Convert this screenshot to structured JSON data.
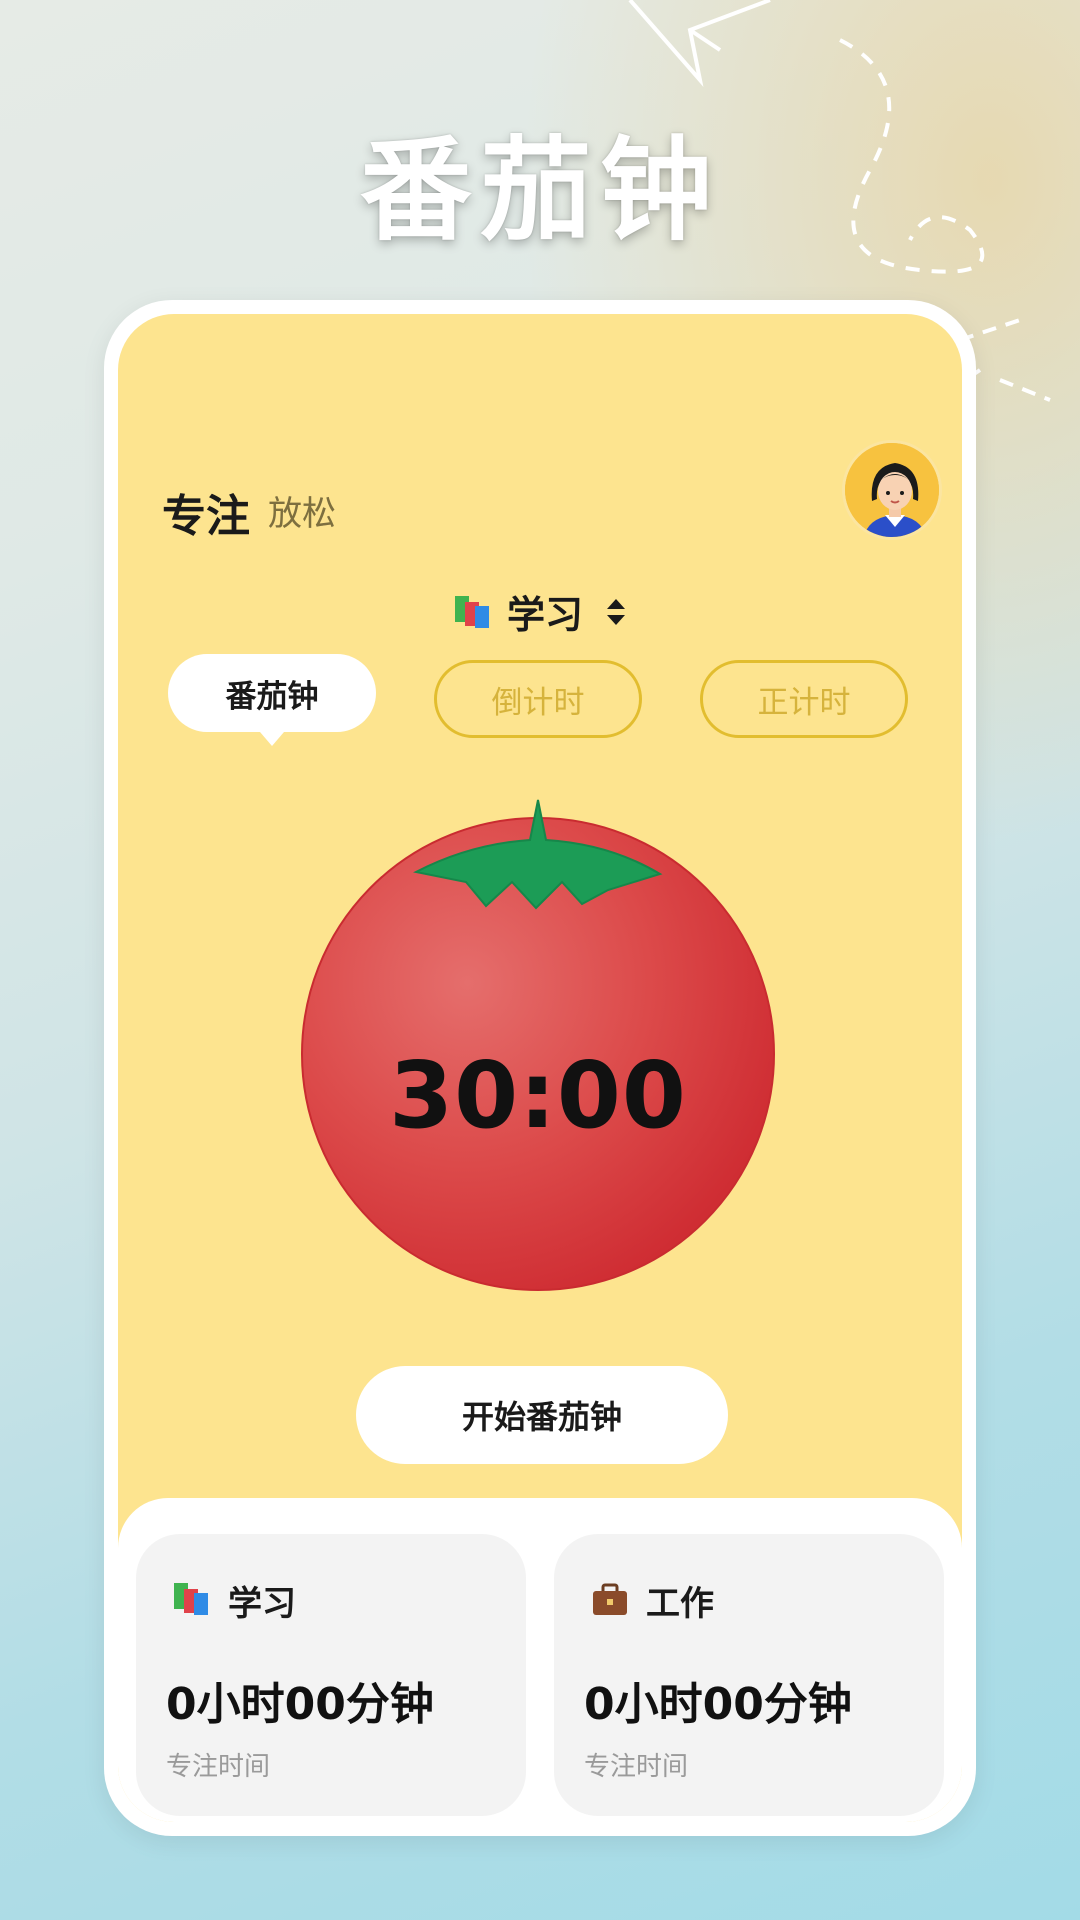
{
  "promo": {
    "title": "番茄钟"
  },
  "header": {
    "tab_focus": "专注",
    "tab_relax": "放松",
    "avatar": "avatar-girl"
  },
  "category": {
    "label": "学习",
    "icon": "books-icon"
  },
  "mode_tabs": [
    {
      "label": "番茄钟",
      "active": true
    },
    {
      "label": "倒计时",
      "active": false
    },
    {
      "label": "正计时",
      "active": false
    }
  ],
  "timer": {
    "display": "30:00"
  },
  "start_button": {
    "label": "开始番茄钟"
  },
  "stats": [
    {
      "label": "学习",
      "icon": "books-icon",
      "value": "0小时00分钟",
      "sub": "专注时间"
    },
    {
      "label": "工作",
      "icon": "briefcase-icon",
      "value": "0小时00分钟",
      "sub": "专注时间"
    }
  ],
  "colors": {
    "screen_bg": "#fde48f",
    "tomato_red": "#d8363a",
    "leaf_green": "#1fa05a",
    "tab_outline": "#e2bd2f"
  }
}
